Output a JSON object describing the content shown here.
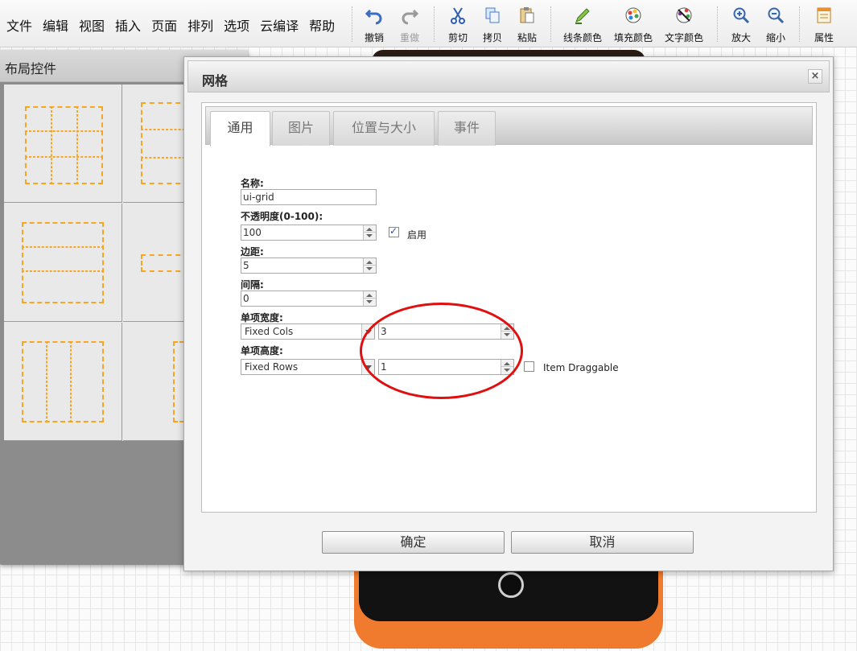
{
  "menu": [
    "文件",
    "编辑",
    "视图",
    "插入",
    "页面",
    "排列",
    "选项",
    "云编译",
    "帮助"
  ],
  "toolbar": {
    "undo": "撤销",
    "redo": "重做",
    "cut": "剪切",
    "copy": "拷贝",
    "paste": "粘贴",
    "line_color": "线条颜色",
    "fill_color": "填充颜色",
    "text_color": "文字颜色",
    "zoom_in": "放大",
    "zoom_out": "缩小",
    "properties": "属性"
  },
  "layout_panel": {
    "title": "布局控件"
  },
  "dialog": {
    "title": "网格",
    "close": "×",
    "tabs": [
      "通用",
      "图片",
      "位置与大小",
      "事件"
    ],
    "fields": {
      "name_label": "名称:",
      "name_value": "ui-grid",
      "opacity_label": "不透明度(0-100):",
      "opacity_value": "100",
      "enable_label": "启用",
      "margin_label": "边距:",
      "margin_value": "5",
      "spacing_label": "间隔:",
      "spacing_value": "0",
      "item_width_label": "单项宽度:",
      "item_width_mode": "Fixed Cols",
      "item_width_value": "3",
      "item_height_label": "单项高度:",
      "item_height_mode": "Fixed Rows",
      "item_height_value": "1",
      "draggable_label": "Item Draggable"
    },
    "enable_checked": true,
    "draggable_checked": false,
    "ok": "确定",
    "cancel": "取消"
  },
  "colors": {
    "annotation": "#e01010",
    "dashed": "#f5a623",
    "phone_orange": "#f07a2e"
  }
}
